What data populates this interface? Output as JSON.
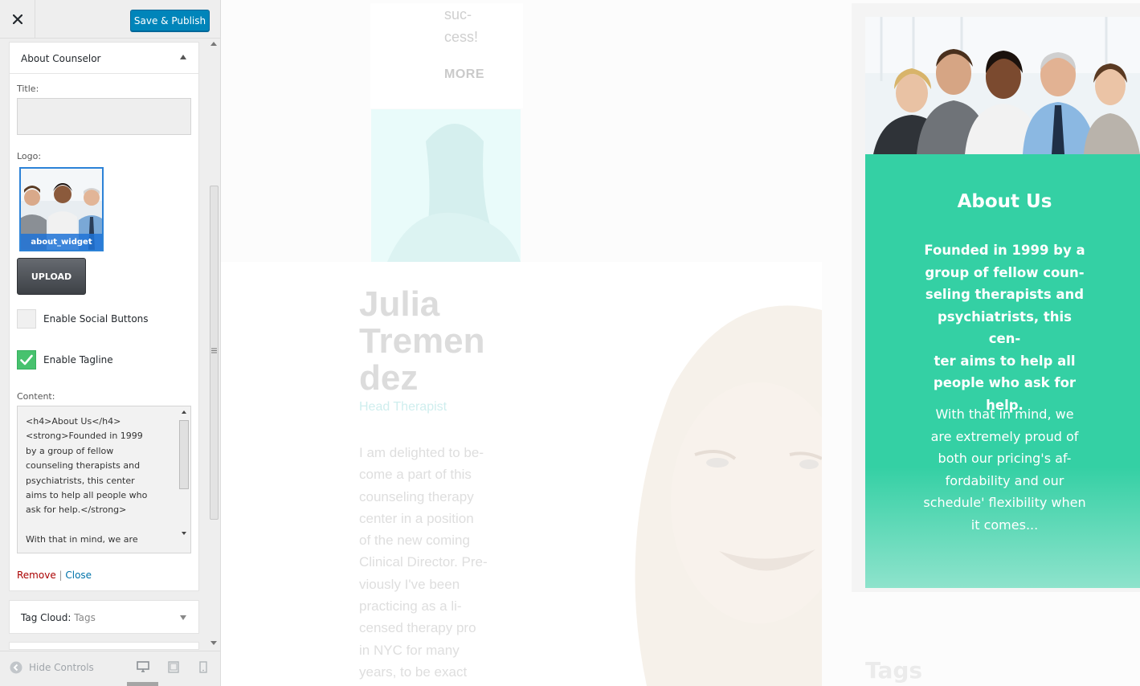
{
  "header": {
    "save_label": "Save & Publish"
  },
  "widget": {
    "title": "About Counselor",
    "title_label": "Title:",
    "title_value": "",
    "logo_label": "Logo:",
    "logo_caption": "about_widget",
    "upload_label": "UPLOAD",
    "social_label": "Enable Social Buttons",
    "social_checked": false,
    "tagline_label": "Enable Tagline",
    "tagline_checked": true,
    "content_label": "Content:",
    "content_value": "<h4>About Us</h4>\n<strong>Founded in 1999\nby a group of fellow\ncounseling therapists and\npsychiatrists, this center\naims to help all people who\nask for help.</strong>\n\nWith that in mind, we are",
    "remove_label": "Remove",
    "separator": " | ",
    "close_label": "Close"
  },
  "tag_cloud": {
    "title": "Tag Cloud:",
    "subtitle": " Tags"
  },
  "footer": {
    "hide_controls_label": "Hide Controls"
  },
  "preview": {
    "top_text": "suc-\ncess!",
    "more_label": "MORE",
    "name": "Julia\nTremen\ndez",
    "role": "Head Therapist",
    "bio": "I am delighted to be-\ncome a part of this\ncounseling therapy\ncenter in a position\nof the new coming\nClinical Director. Pre-\nviously I've been\npracticing as a li-\ncensed therapy pro\nin NYC for many\nyears, to be exact",
    "about_title": "About Us",
    "about_p1": "Founded in 1999 by a\ngroup of fellow coun-\nseling therapists and\npsychiatrists, this cen-\nter aims to help all\npeople who ask for\nhelp.",
    "about_p2": "With that in mind, we\nare extremely proud of\nboth our pricing's af-\nfordability and our\nschedule' flexibility when\nit comes...",
    "tags_heading": "Tags"
  },
  "colors": {
    "primary_button": "#0085ba",
    "about_green": "#34d0a4",
    "checkbox_on": "#47c26e",
    "remove_link": "#aa0000",
    "close_link": "#0073aa"
  },
  "icons": {
    "close": "close-icon",
    "collapse": "arrow-up-icon",
    "expand": "arrow-down-icon",
    "check": "checkmark-icon",
    "hide_controls": "collapse-circle-icon",
    "desktop": "desktop-icon",
    "tablet": "tablet-icon",
    "mobile": "mobile-icon"
  }
}
